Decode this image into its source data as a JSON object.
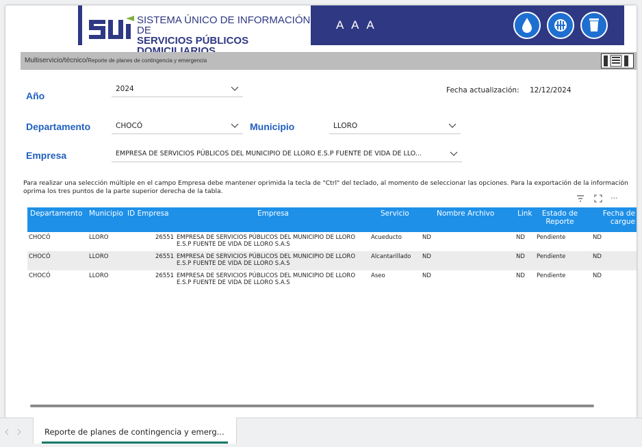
{
  "header": {
    "logo_line1": "SISTEMA ÚNICO DE INFORMACIÓN DE",
    "logo_line2": "SERVICIOS PÚBLICOS DOMICILIARIOS",
    "aaa": "A A A",
    "service_icons": [
      "water-drop-icon",
      "recycle-sewer-icon",
      "trash-bin-icon"
    ],
    "brand_color": "#2f3883"
  },
  "breadcrumb": {
    "path": "Multiservicio/técnico/",
    "current": "Reporte de planes de contingencia y emergencia"
  },
  "filters": {
    "anio_label": "Año",
    "anio_value": "2024",
    "departamento_label": "Departamento",
    "departamento_value": "CHOCÓ",
    "municipio_label": "Municipio",
    "municipio_value": "LLORO",
    "empresa_label": "Empresa",
    "empresa_value": "EMPRESA DE SERVICIOS PÚBLICOS DEL MUNICIPIO DE LLORO E.S.P FUENTE DE VIDA DE LLO..."
  },
  "update": {
    "label": "Fecha actualización:",
    "value": "12/12/2024"
  },
  "note": "Para realizar una selección múltiple en el campo Empresa debe mantener oprimida la tecla de \"Ctrl\" del teclado, al momento de seleccionar las opciones. Para la exportación de la información oprima los tres puntos de la parte superior derecha de la tabla.",
  "table": {
    "header_color": "#1e90e8",
    "more_label": "...",
    "columns": [
      "Departamento",
      "Municipio",
      "ID Empresa",
      "Empresa",
      "Servicio",
      "Nombre Archivo",
      "Link",
      "Estado de Reporte",
      "Fecha de cargue"
    ],
    "rows": [
      {
        "departamento": "CHOCÓ",
        "municipio": "LLORO",
        "id": "26551",
        "empresa1": "EMPRESA DE SERVICIOS PÚBLICOS DEL MUNICIPIO DE LLORO",
        "empresa2": "E.S.P FUENTE DE VIDA DE LLORO S.A.S",
        "servicio": "Acueducto",
        "archivo": "ND",
        "link": "ND",
        "estado": "Pendiente",
        "fecha": "ND"
      },
      {
        "departamento": "CHOCÓ",
        "municipio": "LLORO",
        "id": "26551",
        "empresa1": "EMPRESA DE SERVICIOS PÚBLICOS DEL MUNICIPIO DE LLORO",
        "empresa2": "E.S.P FUENTE DE VIDA DE LLORO S.A.S",
        "servicio": "Alcantarillado",
        "archivo": "ND",
        "link": "ND",
        "estado": "Pendiente",
        "fecha": "ND"
      },
      {
        "departamento": "CHOCÓ",
        "municipio": "LLORO",
        "id": "26551",
        "empresa1": "EMPRESA DE SERVICIOS PÚBLICOS DEL MUNICIPIO DE LLORO",
        "empresa2": "E.S.P FUENTE DE VIDA DE LLORO S.A.S",
        "servicio": "Aseo",
        "archivo": "ND",
        "link": "ND",
        "estado": "Pendiente",
        "fecha": "ND"
      }
    ]
  },
  "tabs": {
    "active": "Reporte de planes de contingencia y emerg...",
    "accent": "#117865"
  }
}
